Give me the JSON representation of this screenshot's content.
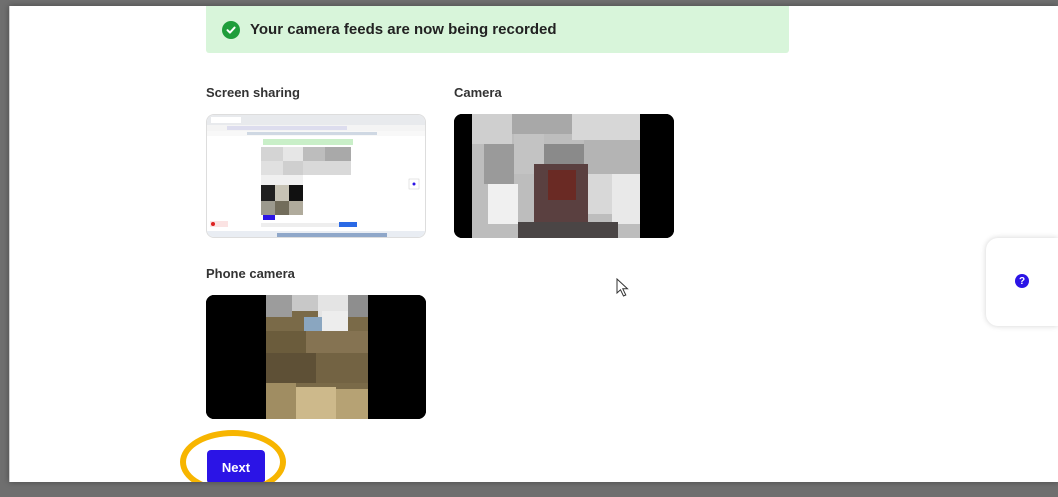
{
  "banner": {
    "text": "Your camera feeds are now being recorded",
    "icon": "check-circle-icon",
    "color": "#d8f5da"
  },
  "feeds": {
    "screen_sharing": {
      "label": "Screen sharing"
    },
    "camera": {
      "label": "Camera"
    },
    "phone_camera": {
      "label": "Phone camera"
    }
  },
  "actions": {
    "next_label": "Next",
    "accent": "#2b14e6",
    "highlight": "#f7b500"
  },
  "help": {
    "glyph": "?",
    "icon": "question-circle-icon"
  }
}
